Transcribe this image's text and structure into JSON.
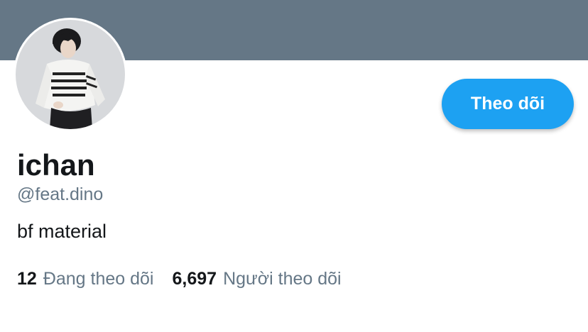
{
  "profile": {
    "name": "ichan",
    "handle": "@feat.dino",
    "bio": "bf material"
  },
  "actions": {
    "follow_label": "Theo dõi"
  },
  "stats": {
    "following_count": "12",
    "following_label": "Đang theo dõi",
    "followers_count": "6,697",
    "followers_label": "Người theo dõi"
  },
  "colors": {
    "banner": "#657786",
    "accent": "#1da1f2",
    "text": "#14171a",
    "muted": "#657786"
  }
}
